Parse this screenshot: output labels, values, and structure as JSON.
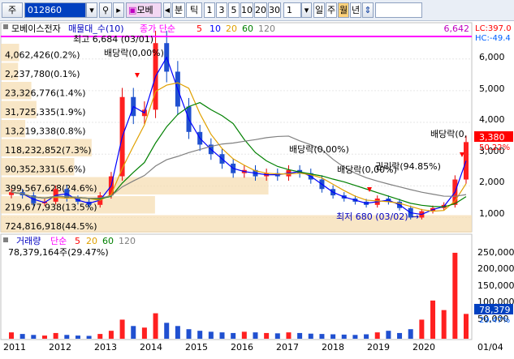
{
  "toolbar": {
    "market": "주",
    "code": "012860",
    "name": "모베",
    "mode": "분",
    "tick_label": "틱",
    "intervals": [
      "1",
      "3",
      "5",
      "10",
      "20",
      "30"
    ],
    "count": "1",
    "periods": [
      "일",
      "주",
      "월",
      "년"
    ],
    "active_period": "월"
  },
  "price_panel": {
    "stock_label": "모베이스전자",
    "chart_kind": "매물대_수(10)",
    "ma_label": "종가 단순",
    "ma_periods": [
      "5",
      "10",
      "20",
      "60",
      "120"
    ],
    "ma_colors": [
      "#ff0000",
      "#0000ff",
      "#e0a000",
      "#008000",
      "#808080"
    ],
    "high_value": "6,642",
    "lc_label": "LC:397.0",
    "hc_label": "HC:-49.4",
    "max_label": "최고 6,684 (03/01)",
    "min_label": "최저 680 (03/02)",
    "current_price": "3,380",
    "current_change": "50.22%",
    "y_ticks": [
      "6,000",
      "5,000",
      "4,000",
      "3,000",
      "2,000",
      "1,000"
    ],
    "dividend_label": "배당락(0,00%)",
    "dividend_label_right": "배당락(0,",
    "rights_label": "권리락(94.85%)",
    "volume_profile": [
      {
        "label": "4,062,426(0.2%)",
        "pct": 0.2
      },
      {
        "label": "2,237,780(0.1%)",
        "pct": 0.1
      },
      {
        "label": "23,326,776(1.4%)",
        "pct": 1.4
      },
      {
        "label": "31,725,335(1.9%)",
        "pct": 1.9
      },
      {
        "label": "13,219,338(0.8%)",
        "pct": 0.8
      },
      {
        "label": "118,232,852(7.3%)",
        "pct": 7.3
      },
      {
        "label": "90,352,331(5.6%)",
        "pct": 5.6
      },
      {
        "label": "399,567,628(24.6%)",
        "pct": 24.6
      },
      {
        "label": "219,677,938(13.5%)",
        "pct": 13.5
      },
      {
        "label": "724,816,918(44.5%)",
        "pct": 44.5
      }
    ]
  },
  "volume_panel": {
    "title": "거래량",
    "ma_label": "단순",
    "ma_periods": [
      "5",
      "20",
      "60",
      "120"
    ],
    "last_value": "78,379,164주(29.47%)",
    "y_ticks": [
      "250,000",
      "200,000",
      "150,000",
      "100,000",
      "50,000"
    ],
    "current_volume": "78,379",
    "current_pct": "29.47%"
  },
  "x_axis": [
    "2011",
    "2012",
    "2013",
    "2014",
    "2015",
    "2016",
    "2017",
    "2018",
    "2019",
    "2020",
    "01/04"
  ],
  "chart_data": {
    "type": "line",
    "x": [
      "2011-01",
      "2011-04",
      "2011-07",
      "2011-10",
      "2012-01",
      "2012-04",
      "2012-07",
      "2012-10",
      "2013-01",
      "2013-04",
      "2013-07",
      "2013-10",
      "2014-01",
      "2014-04",
      "2014-07",
      "2014-10",
      "2015-01",
      "2015-04",
      "2015-07",
      "2015-10",
      "2016-01",
      "2016-04",
      "2016-07",
      "2016-10",
      "2017-01",
      "2017-04",
      "2017-07",
      "2017-10",
      "2018-01",
      "2018-04",
      "2018-07",
      "2018-10",
      "2019-01",
      "2019-04",
      "2019-07",
      "2019-10",
      "2020-01",
      "2020-04",
      "2020-07",
      "2020-10",
      "2020-12",
      "2021-01"
    ],
    "series": [
      {
        "values": [
          1800,
          1700,
          1450,
          1500,
          1900,
          1600,
          1500,
          1400,
          1700,
          2300,
          4800,
          4200,
          4400,
          6500,
          5600,
          4500,
          3700,
          3300,
          3000,
          2700,
          2400,
          2500,
          2300,
          2400,
          2300,
          2500,
          2400,
          2200,
          1900,
          1700,
          1600,
          1500,
          1400,
          1600,
          1500,
          1300,
          1000,
          1200,
          1300,
          1400,
          2200,
          3380
        ]
      }
    ],
    "ylim": [
      680,
      6684
    ],
    "volume": [
      20,
      15,
      12,
      10,
      18,
      12,
      10,
      9,
      15,
      25,
      60,
      40,
      35,
      80,
      50,
      40,
      30,
      25,
      22,
      20,
      18,
      22,
      20,
      18,
      17,
      20,
      18,
      16,
      15,
      14,
      13,
      12,
      14,
      20,
      25,
      18,
      30,
      60,
      120,
      90,
      270,
      78
    ]
  }
}
